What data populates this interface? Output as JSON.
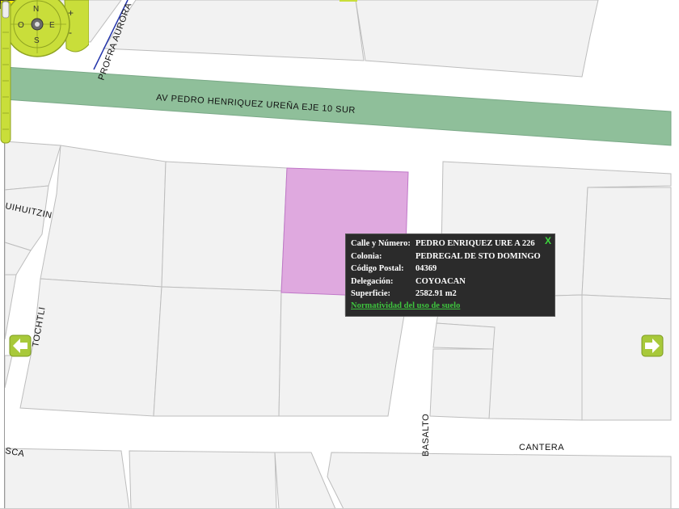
{
  "streets": {
    "main_avenue": "AV PEDRO HENRIQUEZ UREÑA EJE 10 SUR",
    "profra_aurora": "PROFRA AURORA",
    "cuihuitzin": "UIHUITZIN",
    "tochtli": "TOCHTLI",
    "basalto": "BASALTO",
    "cantera": "CANTERA",
    "bottom_left": "SCA"
  },
  "popup": {
    "rows": [
      {
        "label": "Calle y Número:",
        "value": "PEDRO ENRIQUEZ URE A 226"
      },
      {
        "label": "Colonia:",
        "value": "PEDREGAL DE STO DOMINGO"
      },
      {
        "label": "Código Postal:",
        "value": "04369"
      },
      {
        "label": "Delegación:",
        "value": "COYOACAN"
      },
      {
        "label": "Superficie:",
        "value": "2582.91 m2"
      }
    ],
    "link": "Normatividad del uso de suelo",
    "close": "X"
  },
  "compass": {
    "north": "N",
    "south": "S",
    "east": "E",
    "west": "O",
    "zoom_in": "+",
    "zoom_out": "-"
  },
  "colors": {
    "avenue": "#8fbf9a",
    "parcel_highlight": "#dfa9df",
    "popup_bg": "#2b2b2b",
    "control_green": "#c9de3a",
    "block_fill": "#f2f2f2"
  }
}
